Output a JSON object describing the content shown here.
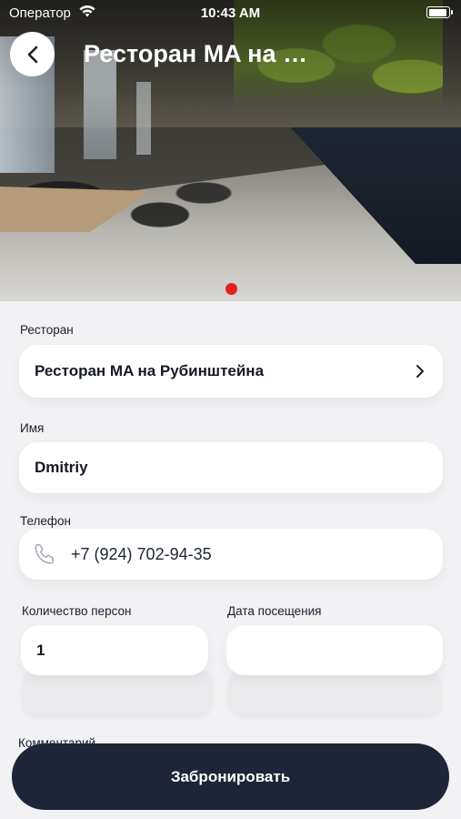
{
  "status_bar": {
    "carrier": "Оператор",
    "time": "10:43 AM",
    "battery_level": 0.95
  },
  "header": {
    "title": "Ресторан MA на …",
    "back_icon": "chevron-left-icon"
  },
  "gallery": {
    "current_page": 1,
    "dot_color": "#e2201c"
  },
  "form": {
    "restaurant": {
      "label": "Ресторан",
      "value": "Ресторан MA на Рубинштейна",
      "icon": "chevron-right-icon"
    },
    "name": {
      "label": "Имя",
      "value": "Dmitriy"
    },
    "phone": {
      "label": "Телефон",
      "value": "+7 (924) 702-94-35",
      "icon": "phone-icon"
    },
    "guests": {
      "label": "Количество персон",
      "value": "1"
    },
    "date": {
      "label": "Дата посещения",
      "value": ""
    },
    "comment": {
      "label": "Комментарий"
    }
  },
  "actions": {
    "book_label": "Забронировать"
  },
  "colors": {
    "primary": "#1e2538",
    "accent": "#e2201c",
    "background": "#f2f2f4",
    "field": "#ffffff"
  }
}
